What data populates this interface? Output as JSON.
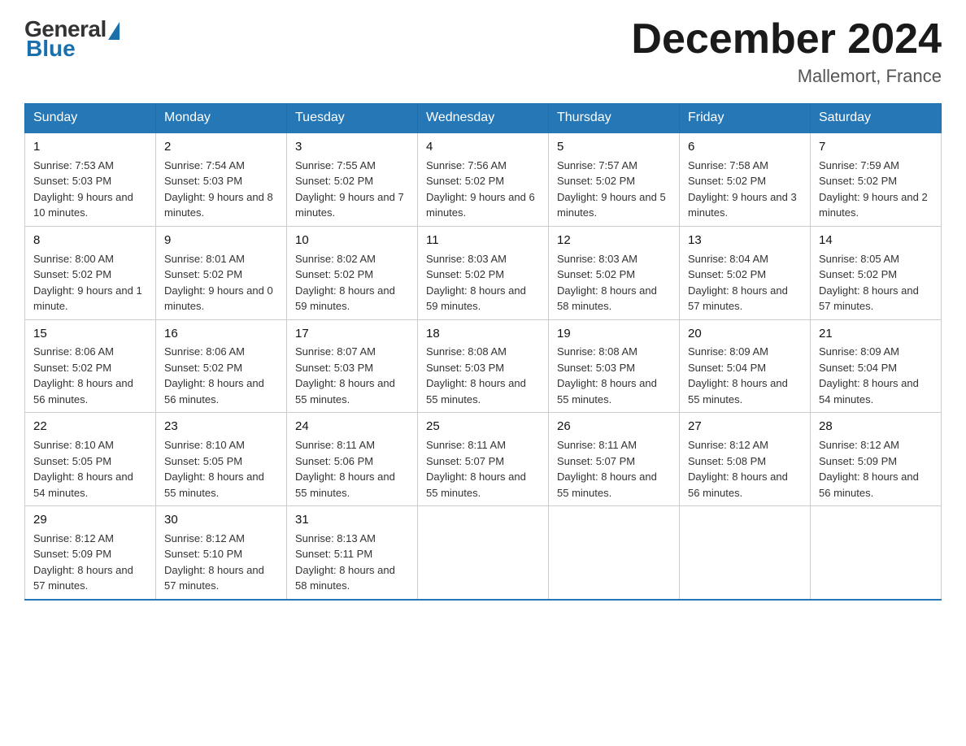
{
  "header": {
    "logo_general": "General",
    "logo_blue": "Blue",
    "month_title": "December 2024",
    "location": "Mallemort, France"
  },
  "days_of_week": [
    "Sunday",
    "Monday",
    "Tuesday",
    "Wednesday",
    "Thursday",
    "Friday",
    "Saturday"
  ],
  "weeks": [
    {
      "days": [
        {
          "num": "1",
          "sunrise": "7:53 AM",
          "sunset": "5:03 PM",
          "daylight": "9 hours and 10 minutes."
        },
        {
          "num": "2",
          "sunrise": "7:54 AM",
          "sunset": "5:03 PM",
          "daylight": "9 hours and 8 minutes."
        },
        {
          "num": "3",
          "sunrise": "7:55 AM",
          "sunset": "5:02 PM",
          "daylight": "9 hours and 7 minutes."
        },
        {
          "num": "4",
          "sunrise": "7:56 AM",
          "sunset": "5:02 PM",
          "daylight": "9 hours and 6 minutes."
        },
        {
          "num": "5",
          "sunrise": "7:57 AM",
          "sunset": "5:02 PM",
          "daylight": "9 hours and 5 minutes."
        },
        {
          "num": "6",
          "sunrise": "7:58 AM",
          "sunset": "5:02 PM",
          "daylight": "9 hours and 3 minutes."
        },
        {
          "num": "7",
          "sunrise": "7:59 AM",
          "sunset": "5:02 PM",
          "daylight": "9 hours and 2 minutes."
        }
      ]
    },
    {
      "days": [
        {
          "num": "8",
          "sunrise": "8:00 AM",
          "sunset": "5:02 PM",
          "daylight": "9 hours and 1 minute."
        },
        {
          "num": "9",
          "sunrise": "8:01 AM",
          "sunset": "5:02 PM",
          "daylight": "9 hours and 0 minutes."
        },
        {
          "num": "10",
          "sunrise": "8:02 AM",
          "sunset": "5:02 PM",
          "daylight": "8 hours and 59 minutes."
        },
        {
          "num": "11",
          "sunrise": "8:03 AM",
          "sunset": "5:02 PM",
          "daylight": "8 hours and 59 minutes."
        },
        {
          "num": "12",
          "sunrise": "8:03 AM",
          "sunset": "5:02 PM",
          "daylight": "8 hours and 58 minutes."
        },
        {
          "num": "13",
          "sunrise": "8:04 AM",
          "sunset": "5:02 PM",
          "daylight": "8 hours and 57 minutes."
        },
        {
          "num": "14",
          "sunrise": "8:05 AM",
          "sunset": "5:02 PM",
          "daylight": "8 hours and 57 minutes."
        }
      ]
    },
    {
      "days": [
        {
          "num": "15",
          "sunrise": "8:06 AM",
          "sunset": "5:02 PM",
          "daylight": "8 hours and 56 minutes."
        },
        {
          "num": "16",
          "sunrise": "8:06 AM",
          "sunset": "5:02 PM",
          "daylight": "8 hours and 56 minutes."
        },
        {
          "num": "17",
          "sunrise": "8:07 AM",
          "sunset": "5:03 PM",
          "daylight": "8 hours and 55 minutes."
        },
        {
          "num": "18",
          "sunrise": "8:08 AM",
          "sunset": "5:03 PM",
          "daylight": "8 hours and 55 minutes."
        },
        {
          "num": "19",
          "sunrise": "8:08 AM",
          "sunset": "5:03 PM",
          "daylight": "8 hours and 55 minutes."
        },
        {
          "num": "20",
          "sunrise": "8:09 AM",
          "sunset": "5:04 PM",
          "daylight": "8 hours and 55 minutes."
        },
        {
          "num": "21",
          "sunrise": "8:09 AM",
          "sunset": "5:04 PM",
          "daylight": "8 hours and 54 minutes."
        }
      ]
    },
    {
      "days": [
        {
          "num": "22",
          "sunrise": "8:10 AM",
          "sunset": "5:05 PM",
          "daylight": "8 hours and 54 minutes."
        },
        {
          "num": "23",
          "sunrise": "8:10 AM",
          "sunset": "5:05 PM",
          "daylight": "8 hours and 55 minutes."
        },
        {
          "num": "24",
          "sunrise": "8:11 AM",
          "sunset": "5:06 PM",
          "daylight": "8 hours and 55 minutes."
        },
        {
          "num": "25",
          "sunrise": "8:11 AM",
          "sunset": "5:07 PM",
          "daylight": "8 hours and 55 minutes."
        },
        {
          "num": "26",
          "sunrise": "8:11 AM",
          "sunset": "5:07 PM",
          "daylight": "8 hours and 55 minutes."
        },
        {
          "num": "27",
          "sunrise": "8:12 AM",
          "sunset": "5:08 PM",
          "daylight": "8 hours and 56 minutes."
        },
        {
          "num": "28",
          "sunrise": "8:12 AM",
          "sunset": "5:09 PM",
          "daylight": "8 hours and 56 minutes."
        }
      ]
    },
    {
      "days": [
        {
          "num": "29",
          "sunrise": "8:12 AM",
          "sunset": "5:09 PM",
          "daylight": "8 hours and 57 minutes."
        },
        {
          "num": "30",
          "sunrise": "8:12 AM",
          "sunset": "5:10 PM",
          "daylight": "8 hours and 57 minutes."
        },
        {
          "num": "31",
          "sunrise": "8:13 AM",
          "sunset": "5:11 PM",
          "daylight": "8 hours and 58 minutes."
        },
        {
          "num": "",
          "sunrise": "",
          "sunset": "",
          "daylight": ""
        },
        {
          "num": "",
          "sunrise": "",
          "sunset": "",
          "daylight": ""
        },
        {
          "num": "",
          "sunrise": "",
          "sunset": "",
          "daylight": ""
        },
        {
          "num": "",
          "sunrise": "",
          "sunset": "",
          "daylight": ""
        }
      ]
    }
  ]
}
